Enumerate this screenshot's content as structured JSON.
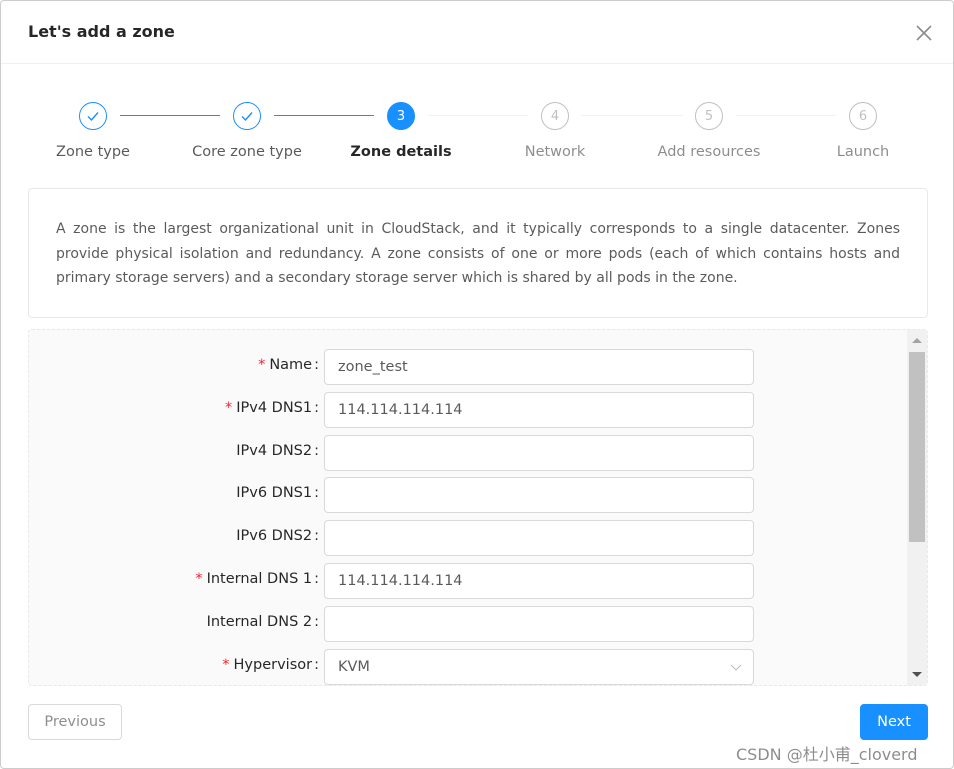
{
  "dialog": {
    "title": "Let's add a zone"
  },
  "steps": [
    {
      "label": "Zone type",
      "status": "done",
      "number": "1"
    },
    {
      "label": "Core zone type",
      "status": "done",
      "number": "2"
    },
    {
      "label": "Zone details",
      "status": "active",
      "number": "3"
    },
    {
      "label": "Network",
      "status": "wait",
      "number": "4"
    },
    {
      "label": "Add resources",
      "status": "wait",
      "number": "5"
    },
    {
      "label": "Launch",
      "status": "wait",
      "number": "6"
    }
  ],
  "description": "A zone is the largest organizational unit in CloudStack, and it typically corresponds to a single datacenter. Zones provide physical isolation and redundancy. A zone consists of one or more pods (each of which contains hosts and primary storage servers) and a secondary storage server which is shared by all pods in the zone.",
  "form": {
    "fields": [
      {
        "label": "Name",
        "required": true,
        "value": "zone_test"
      },
      {
        "label": "IPv4 DNS1",
        "required": true,
        "value": "114.114.114.114"
      },
      {
        "label": "IPv4 DNS2",
        "required": false,
        "value": ""
      },
      {
        "label": "IPv6 DNS1",
        "required": false,
        "value": ""
      },
      {
        "label": "IPv6 DNS2",
        "required": false,
        "value": ""
      },
      {
        "label": "Internal DNS 1",
        "required": true,
        "value": "114.114.114.114"
      },
      {
        "label": "Internal DNS 2",
        "required": false,
        "value": ""
      },
      {
        "label": "Hypervisor",
        "required": true,
        "value": "KVM",
        "type": "select"
      }
    ],
    "label_suffix": ":",
    "required_mark": "*"
  },
  "footer": {
    "previous_label": "Previous",
    "next_label": "Next"
  },
  "watermark": "CSDN @杜小甫_cloverd",
  "colors": {
    "primary": "#1890ff",
    "required": "#f5222d"
  }
}
